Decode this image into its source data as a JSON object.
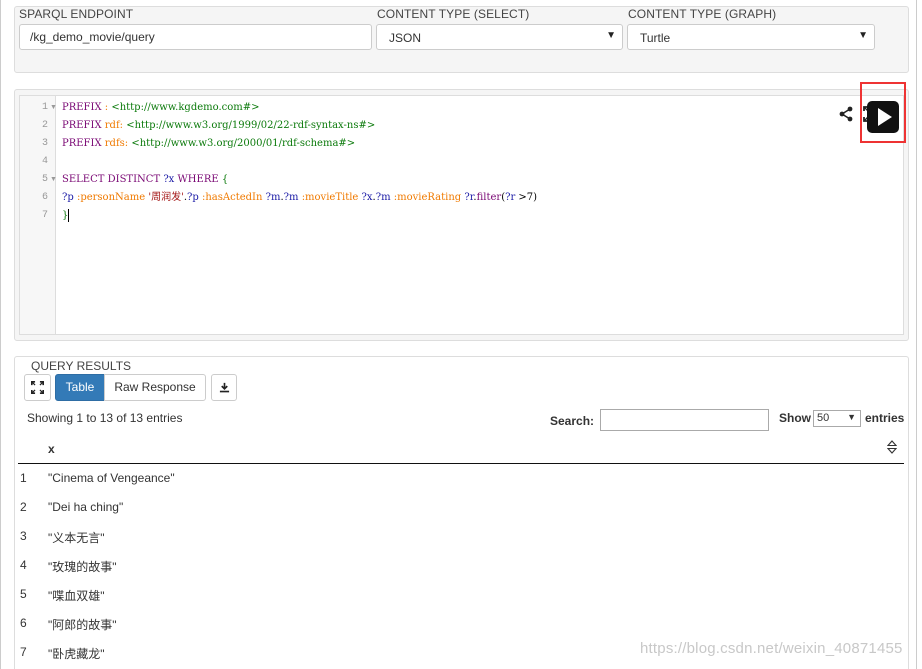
{
  "endpoint": {
    "label": "SPARQL ENDPOINT",
    "value": "/kg_demo_movie/query"
  },
  "content_type_select": {
    "label": "CONTENT TYPE (SELECT)",
    "value": "JSON"
  },
  "content_type_graph": {
    "label": "CONTENT TYPE (GRAPH)",
    "value": "Turtle"
  },
  "editor": {
    "line_numbers": [
      "1",
      "2",
      "3",
      "4",
      "5",
      "6",
      "7"
    ],
    "lines": [
      "PREFIX : <http://www.kgdemo.com#>",
      "PREFIX rdf: <http://www.w3.org/1999/02/22-rdf-syntax-ns#>",
      "PREFIX rdfs: <http://www.w3.org/2000/01/rdf-schema#>",
      "",
      "SELECT DISTINCT ?x WHERE {",
      "?p :personName '周润发'.?p :hasActedIn ?m.?m :movieTitle ?x.?m :movieRating ?r.filter(?r >7)",
      "}"
    ],
    "icons": [
      "share-icon",
      "fullscreen-icon",
      "run-query-icon"
    ]
  },
  "results": {
    "title": "QUERY RESULTS",
    "tabs": {
      "table": "Table",
      "raw": "Raw Response"
    },
    "info": "Showing 1 to 13 of 13 entries",
    "search_label": "Search:",
    "search_value": "",
    "show_label": "Show",
    "show_value": "50",
    "entries_label": "entries",
    "column_header": "x",
    "rows": [
      {
        "num": "1",
        "value": "\"Cinema of Vengeance\""
      },
      {
        "num": "2",
        "value": "\"Dei ha ching\""
      },
      {
        "num": "3",
        "value": "\"义本无言\""
      },
      {
        "num": "4",
        "value": "\"玫瑰的故事\""
      },
      {
        "num": "5",
        "value": "\"喋血双雄\""
      },
      {
        "num": "6",
        "value": "\"阿郎的故事\""
      },
      {
        "num": "7",
        "value": "\"卧虎藏龙\""
      }
    ]
  },
  "watermark": "https://blog.csdn.net/weixin_40871455",
  "colors": {
    "accent": "#337ab7",
    "highlight": "#e33333"
  }
}
